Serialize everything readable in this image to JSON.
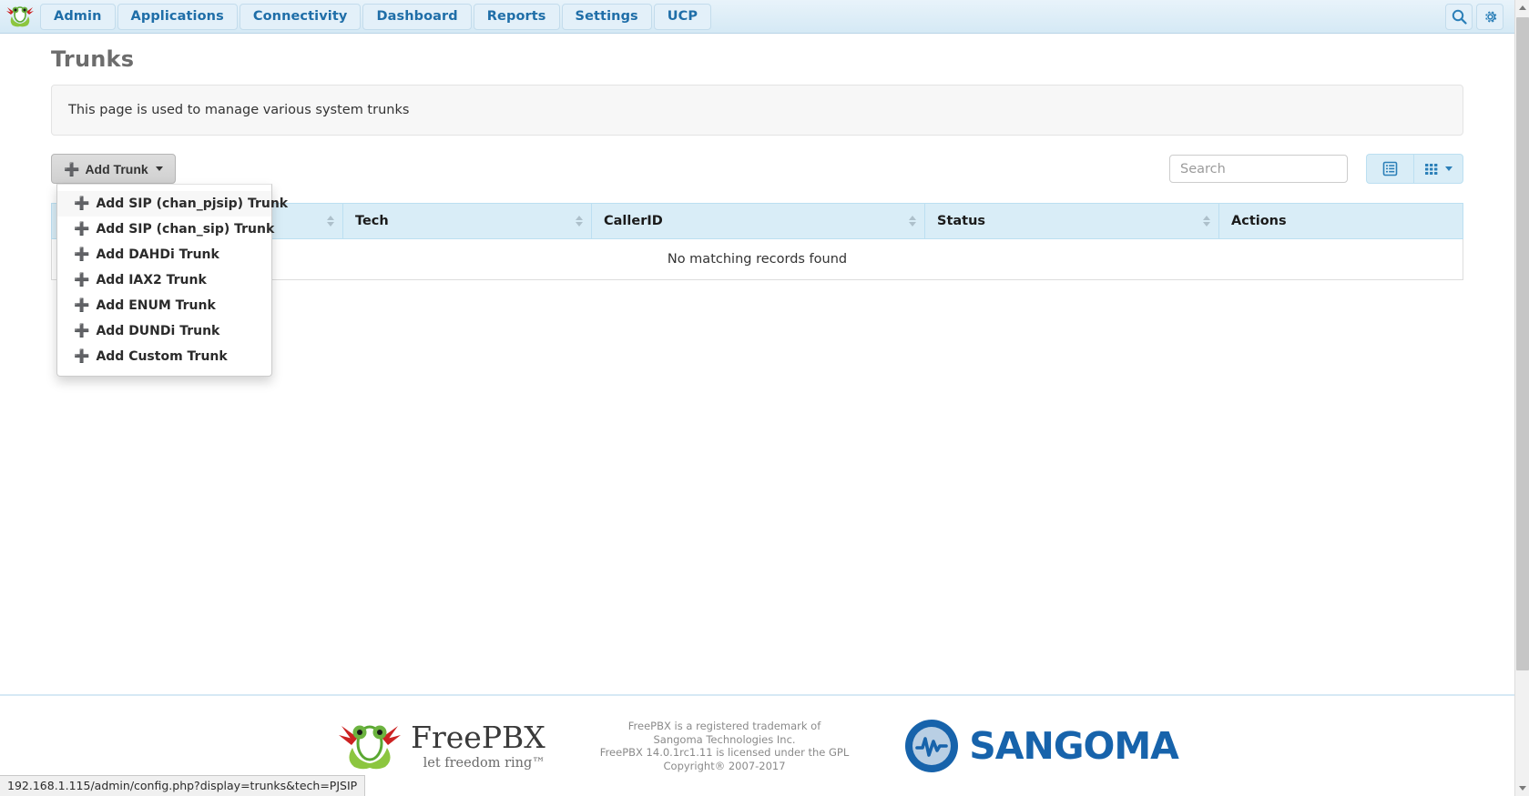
{
  "navbar": {
    "logo_name": "freepbx-frog-logo",
    "items": [
      {
        "label": "Admin"
      },
      {
        "label": "Applications"
      },
      {
        "label": "Connectivity"
      },
      {
        "label": "Dashboard"
      },
      {
        "label": "Reports"
      },
      {
        "label": "Settings"
      },
      {
        "label": "UCP"
      }
    ],
    "search_icon": "search-icon",
    "gear_icon": "gear-icon"
  },
  "page": {
    "title": "Trunks",
    "info_text": "This page is used to manage various system trunks"
  },
  "toolbar": {
    "add_trunk_label": "Add Trunk",
    "dropdown_items": [
      {
        "label": "Add SIP (chan_pjsip) Trunk",
        "active": true
      },
      {
        "label": "Add SIP (chan_sip) Trunk",
        "active": false
      },
      {
        "label": "Add DAHDi Trunk",
        "active": false
      },
      {
        "label": "Add IAX2 Trunk",
        "active": false
      },
      {
        "label": "Add ENUM Trunk",
        "active": false
      },
      {
        "label": "Add DUNDi Trunk",
        "active": false
      },
      {
        "label": "Add Custom Trunk",
        "active": false
      }
    ],
    "search_placeholder": "Search",
    "search_value": "",
    "view_toggle_icon": "list-view-icon",
    "column_chooser_icon": "grid-columns-icon"
  },
  "table": {
    "columns": [
      "",
      "Tech",
      "CallerID",
      "Status",
      "Actions"
    ],
    "rows": [],
    "empty_message": "No matching records found"
  },
  "footer": {
    "freepbx_wordmark": "FreePBX",
    "freepbx_tagline": "let freedom ring™",
    "legal_line1": "FreePBX is a registered trademark of",
    "legal_line2": "Sangoma Technologies Inc.",
    "legal_line3": "FreePBX 14.0.1rc1.11 is licensed under the GPL",
    "legal_line4": "Copyright® 2007-2017",
    "sangoma_wordmark": "SANGOMA"
  },
  "status_bar": {
    "url": "192.168.1.115/admin/config.php?display=trunks&tech=PJSIP"
  },
  "colors": {
    "nav_bg": "#d5e9f5",
    "nav_text": "#1f6ea8",
    "table_header_bg": "#d9edf7",
    "sangoma_blue": "#1763ab",
    "title_gray": "#6d6d6d"
  }
}
